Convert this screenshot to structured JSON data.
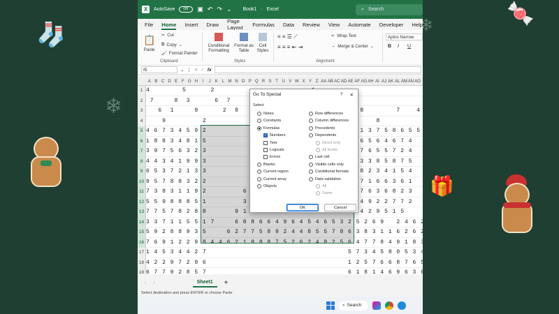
{
  "title_bar": {
    "autosave_label": "AutoSave",
    "autosave_state": "Off",
    "file_name": "Book1",
    "app_name": "Excel",
    "search_placeholder": "Search"
  },
  "menu_tabs": [
    "File",
    "Home",
    "Insert",
    "Draw",
    "Page Layout",
    "Formulas",
    "Data",
    "Review",
    "View",
    "Automate",
    "Developer",
    "Help"
  ],
  "active_tab": "Home",
  "ribbon": {
    "paste": "Paste",
    "cut": "Cut",
    "copy": "Copy",
    "format_painter": "Format Painter",
    "clipboard_group": "Clipboard",
    "conditional_formatting": "Conditional Formatting",
    "format_as_table": "Format as Table",
    "cell_styles": "Cell Styles",
    "styles_group": "Styles",
    "wrap_text": "Wrap Text",
    "merge_center": "Merge & Center",
    "alignment_group": "Alignment",
    "font_name": "Aptos Narrow",
    "bold": "B",
    "italic": "I",
    "underline": "U"
  },
  "formula_bar": {
    "name_box": "I5",
    "fx": "fx",
    "value": ""
  },
  "column_headers": [
    "A",
    "B",
    "C",
    "D",
    "E",
    "F",
    "G",
    "H",
    "I",
    "J",
    "K",
    "L",
    "M",
    "N",
    "O",
    "P",
    "Q",
    "R",
    "S",
    "T",
    "U",
    "V",
    "W",
    "X",
    "Y",
    "Z",
    "AA",
    "AB",
    "AC",
    "AD",
    "AE",
    "AF",
    "AG",
    "AH",
    "AI",
    "AJ",
    "AK",
    "AL",
    "AM",
    "AN",
    "AO"
  ],
  "rows": [
    {
      "num": "1",
      "cells": "4        5      2                        1 "
    },
    {
      "num": "2",
      "cells": " 7     8  3      6  7                     3    9  "
    },
    {
      "num": "3",
      "cells": "   6  1     9      2  8    1                    1    8        7    4"
    },
    {
      "num": "4",
      "cells": "    9         2                                 2        8"
    },
    {
      "num": "5",
      "cells": "4 6 7 3 4 5 9 2                                  8 6 1 3 7 5 8 6 5 5"
    },
    {
      "num": "6",
      "cells": "1 8 8 3 4 8 1 5                                  9 5 6 5 6 4 6 7 4"
    },
    {
      "num": "7",
      "cells": "3 9 7 5 6 3 2 3                                  1 5 7 6 5 5 7 2 4"
    },
    {
      "num": "8",
      "cells": "4 4 3 4 1 9 9 3                                  7 4 3 3 8 5 8 7 5"
    },
    {
      "num": "9",
      "cells": "6 5 3 7 2 1 3 3                                  1 7 8 2 3 4 1 5 4"
    },
    {
      "num": "10",
      "cells": "9 5 7 8 8 3 2 2           1                    7 5 5 7 1 6 6 3 6 1"
    },
    {
      "num": "11",
      "cells": "7 3 8 3 1 1 9 2         6 2                    4 5 1 7 6 3 6 8 2 3"
    },
    {
      "num": "12",
      "cells": "5 5 9 8 8 8 5 1         3 5 4                  7 1 4 4 9 2 2 7 7 2"
    },
    {
      "num": "13",
      "cells": "7 7 5 7 8 2 8 8       9 1 3 1                  5 1 4 4 2 9 5 1 5"
    },
    {
      "num": "14",
      "cells": "3 3 7 1 1 5 5 1 7     6 8 8 6 6 4 9 6 4 5 4 6 5 3 2 5 2 6 9   2 4 6 2 9 2 5 4 3 2 4"
    },
    {
      "num": "15",
      "cells": "5 9 2 8 8 9 3 5     6 2 7 7 5 8 9 2 4 4 8 5 5 7 8 6 3 8 3 1 1 6 2 6 2 1 5 5 3 4 5 5"
    },
    {
      "num": "16",
      "cells": "7 6 9 1 2 2 9 8 4 4 6 2 1 8 8 8 7 5 2 6 2 4 8 2 5 6 4 7 7 8 4 9 1 8 3 3 8 6 2 9 3"
    },
    {
      "num": "17",
      "cells": "1 4 5 3 4 4 2 7                                   5 7 3 4 5 8 0 5 3 4"
    },
    {
      "num": "18",
      "cells": "4 2 2 9 7 2 9 6                                   1 2 5 7 6 6 8 7 6 5"
    },
    {
      "num": "19",
      "cells": "6 7 7 9 2 8 5 7                                   6 1 8 1 4 6 9 6 3 6"
    }
  ],
  "sheet_tabs": {
    "active": "Sheet1",
    "add": "+"
  },
  "status_text": "Select destination and press ENTER or choose Paste",
  "taskbar": {
    "search": "Search"
  },
  "dialog": {
    "title": "Go To Special",
    "help": "?",
    "close": "✕",
    "select_label": "Select",
    "left_options": [
      {
        "label": "Notes",
        "selected": false
      },
      {
        "label": "Constants",
        "selected": false
      },
      {
        "label": "Formulas",
        "selected": true
      },
      {
        "label": "Blanks",
        "selected": false
      },
      {
        "label": "Current region",
        "selected": false
      },
      {
        "label": "Current array",
        "selected": false
      },
      {
        "label": "Objects",
        "selected": false
      }
    ],
    "formula_checks": [
      {
        "label": "Numbers",
        "checked": true
      },
      {
        "label": "Text",
        "checked": false
      },
      {
        "label": "Logicals",
        "checked": false
      },
      {
        "label": "Errors",
        "checked": false
      }
    ],
    "right_options": [
      {
        "label": "Row differences"
      },
      {
        "label": "Column differences"
      },
      {
        "label": "Precedents"
      },
      {
        "label": "Dependents"
      },
      {
        "label": "Last cell"
      },
      {
        "label": "Visible cells only"
      },
      {
        "label": "Conditional formats"
      },
      {
        "label": "Data validation"
      }
    ],
    "dependents_sub": [
      "Direct only",
      "All levels"
    ],
    "validation_sub": [
      "All",
      "Same"
    ],
    "ok": "OK",
    "cancel": "Cancel"
  },
  "colors": {
    "background": "#1f3f32",
    "excel_green": "#217346",
    "selection": "#2b63b5"
  }
}
